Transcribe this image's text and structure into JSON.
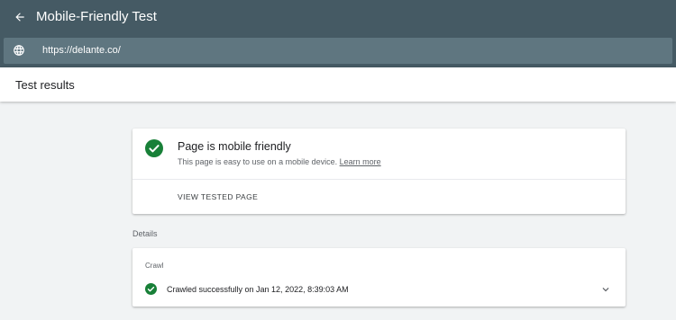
{
  "app": {
    "title": "Mobile-Friendly Test",
    "url": "https://delante.co/"
  },
  "results": {
    "title": "Test results"
  },
  "summary": {
    "heading": "Page is mobile friendly",
    "description": "This page is easy to use on a mobile device.",
    "link_label": "Learn more",
    "view_button_label": "VIEW TESTED PAGE"
  },
  "details": {
    "label": "Details",
    "crawl": {
      "label": "Crawl",
      "status": "Crawled successfully on Jan 12, 2022, 8:39:03 AM"
    }
  },
  "icons": {
    "back": "arrow-back-icon",
    "globe": "globe-icon",
    "check": "check-circle-icon",
    "expand": "chevron-down-icon"
  },
  "colors": {
    "appbar": "#455a64",
    "urlbar": "#5f7680",
    "success": "#188038"
  }
}
